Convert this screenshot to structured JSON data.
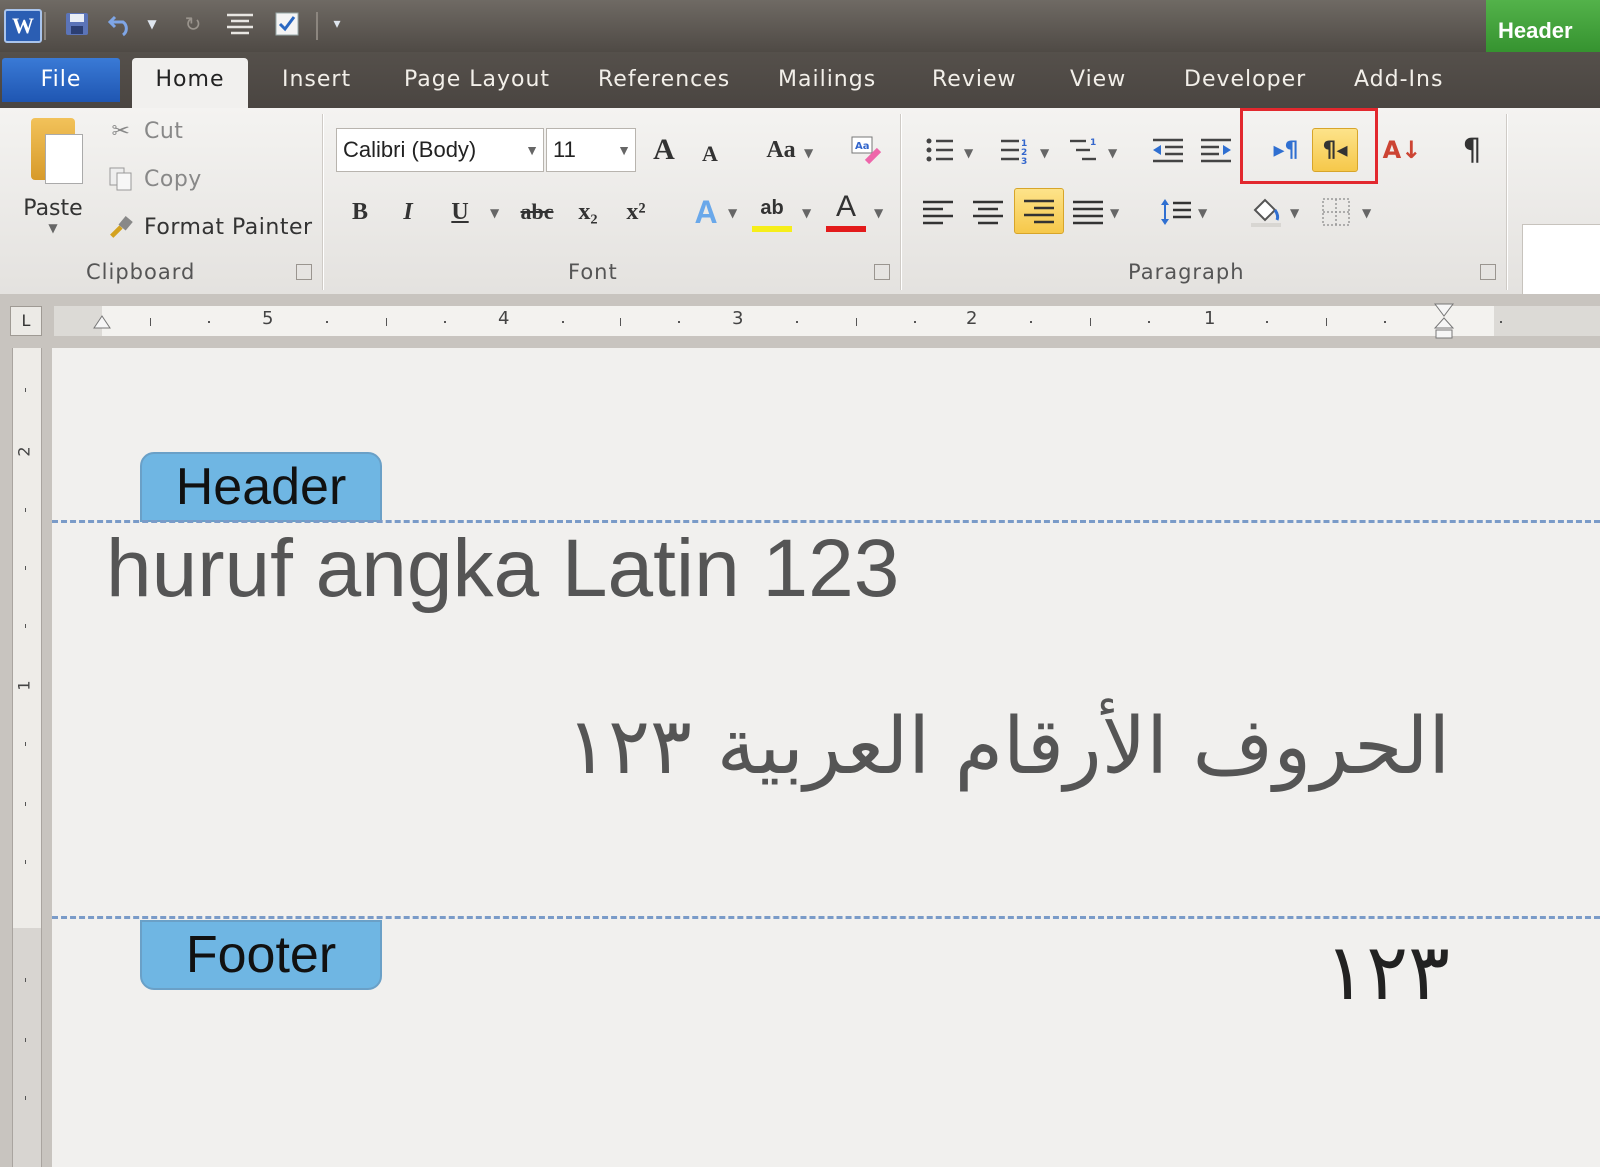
{
  "quick_access": {
    "app_icon": "W",
    "icons": [
      "save-icon",
      "undo-icon",
      "redo-icon",
      "align-icon",
      "checkbox-icon",
      "customize-icon"
    ]
  },
  "context_tab": "Header",
  "tabs": [
    "File",
    "Home",
    "Insert",
    "Page Layout",
    "References",
    "Mailings",
    "Review",
    "View",
    "Developer",
    "Add-Ins"
  ],
  "clipboard": {
    "paste": "Paste",
    "cut": "Cut",
    "copy": "Copy",
    "format_painter": "Format Painter",
    "label": "Clipboard"
  },
  "font": {
    "font_name": "Calibri (Body)",
    "font_size": "11",
    "label": "Font",
    "bold": "B",
    "italic": "I",
    "underline": "U",
    "strikethrough": "abc",
    "subscript": "x₂",
    "superscript": "x²",
    "grow": "A",
    "shrink": "A",
    "change_case": "Aa",
    "text_effects": "A",
    "highlight": "ab",
    "font_color": "A"
  },
  "paragraph": {
    "label": "Paragraph",
    "ltr": "▸¶",
    "rtl": "¶◂",
    "sort": "A↓",
    "show_marks": "¶"
  },
  "ruler": {
    "corner": "L",
    "numbers": [
      "5",
      "4",
      "3",
      "2",
      "1"
    ],
    "vertical_numbers": [
      "2",
      "1"
    ]
  },
  "document": {
    "header_tag": "Header",
    "footer_tag": "Footer",
    "latin_text": "huruf angka Latin 123",
    "arabic_text": "الحروف الأرقام العربية ١٢٣",
    "footer_number": "١٢٣"
  },
  "colors": {
    "accent_blue": "#2b5eb3",
    "context_green": "#3f9e38",
    "highlight_yellow": "#f6c84a",
    "highlight_box_red": "#e2282e",
    "tag_blue": "#6fb6e3"
  }
}
